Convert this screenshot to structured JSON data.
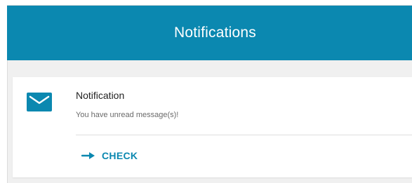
{
  "header": {
    "title": "Notifications"
  },
  "notification": {
    "icon": "mail-icon",
    "title": "Notification",
    "message": "You have unread message(s)!",
    "action_icon": "arrow-right-icon",
    "action_label": "CHECK"
  },
  "colors": {
    "accent": "#0b88b0",
    "background": "#f0f0f0",
    "card": "#ffffff",
    "title_text": "#222222",
    "secondary_text": "#6a6a6a"
  }
}
